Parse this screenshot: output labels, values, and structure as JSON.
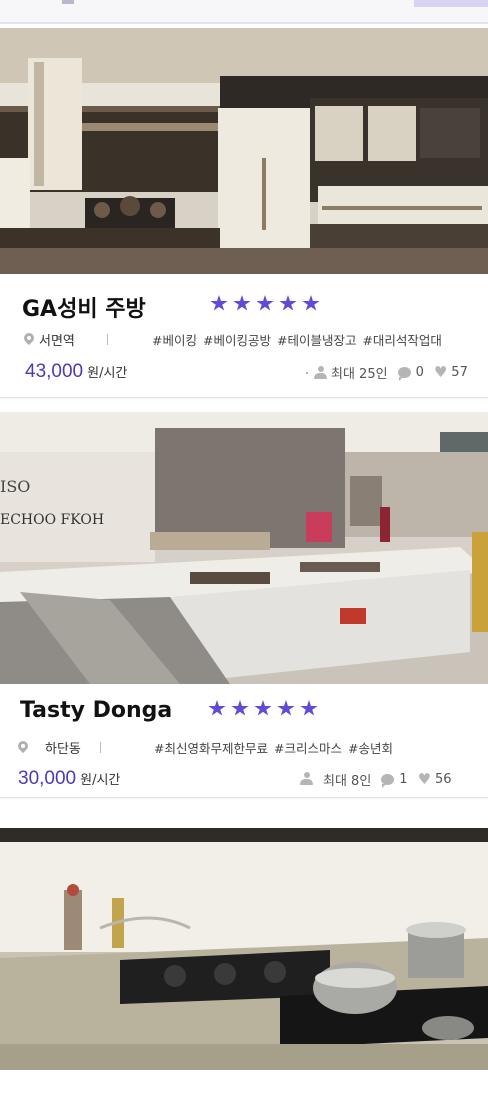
{
  "listings": [
    {
      "title": "GA성비 주방",
      "rating": 5,
      "location": "서면역",
      "tags": [
        "#베이킹",
        "#베이킹공방",
        "#테이블냉장고",
        "#대리석작업대"
      ],
      "price": "43,000",
      "price_unit": "원/시간",
      "capacity": "최대 25인",
      "comments": "0",
      "likes": "57"
    },
    {
      "title": "Tasty Donga",
      "rating": 5,
      "location": "하단동",
      "tags": [
        "#최신영화무제한무료",
        "#크리스마스",
        "#송년회"
      ],
      "price": "30,000",
      "price_unit": "원/시간",
      "capacity": "최대 8인",
      "comments": "1",
      "likes": "56"
    }
  ],
  "colors": {
    "accent": "#5f4bd8",
    "price": "#4a3ab8",
    "icon": "#b5b5b5"
  },
  "icons": {
    "location": "location-pin-icon",
    "capacity": "person-icon",
    "comments": "chat-bubble-icon",
    "likes": "heart-icon",
    "rating": "star-icon"
  }
}
